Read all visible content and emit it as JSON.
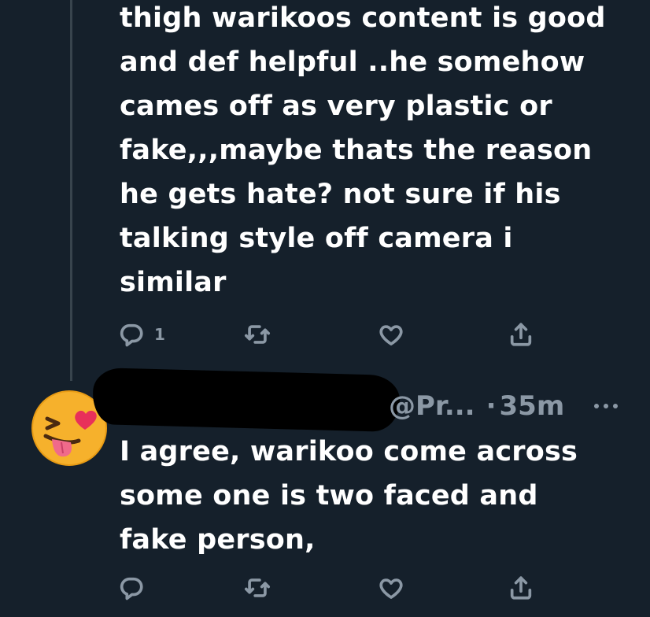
{
  "tweet1": {
    "text": "thigh warikoos content is good\nand def helpful ..he somehow\ncames off as very plastic or\nfake,,,maybe thats the reason\nhe gets hate? not sure if his\ntalking style off camera i\nsimilar",
    "reply_count": "1",
    "icons": [
      "reply-icon",
      "retweet-icon",
      "like-icon",
      "share-icon"
    ]
  },
  "tweet2": {
    "handle": "@Pr...",
    "separator": "·",
    "time": "35m",
    "avatar_icon": "heart-eyes-tongue-emoji",
    "text": "I agree, warikoo come across\nsome one is two faced and\nfake person,",
    "icons": [
      "reply-icon",
      "retweet-icon",
      "like-icon",
      "share-icon",
      "more-icon"
    ]
  },
  "colors": {
    "background": "#15202b",
    "text": "#ffffff",
    "secondary": "#8b98a5",
    "thread_line": "#38444d",
    "redaction": "#000000"
  }
}
